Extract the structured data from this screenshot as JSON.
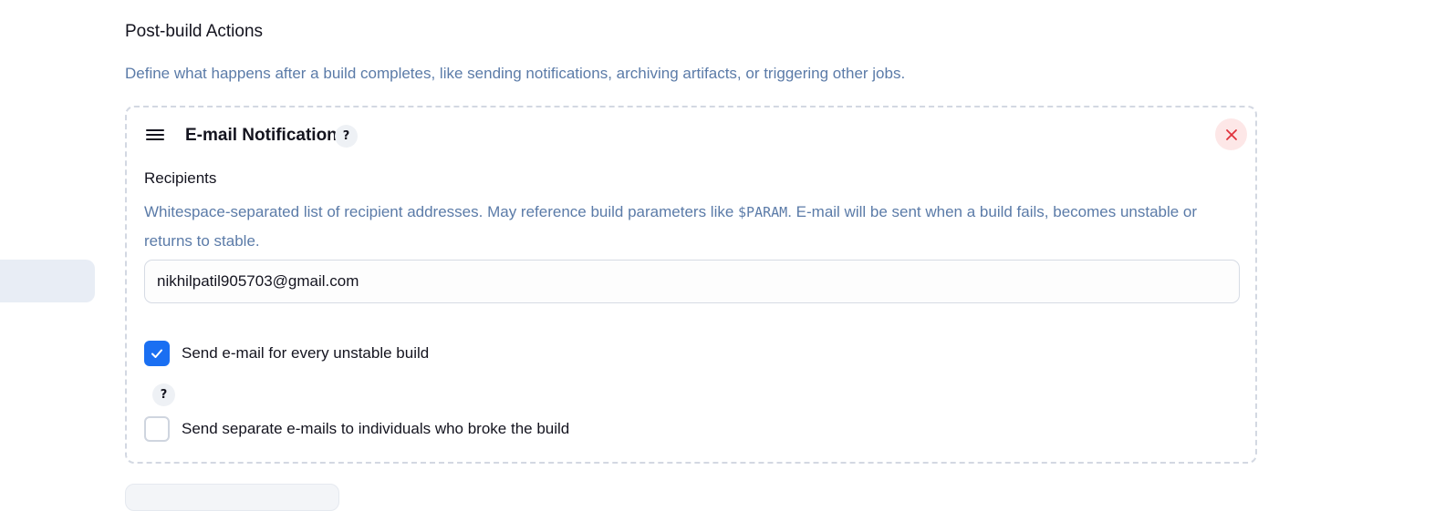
{
  "section": {
    "title": "Post-build Actions",
    "description": "Define what happens after a build completes, like sending notifications, archiving artifacts, or triggering other jobs."
  },
  "email_notification": {
    "title": "E-mail Notification",
    "help_label": "?",
    "recipients": {
      "label": "Recipients",
      "description_before": "Whitespace-separated list of recipient addresses. May reference build parameters like ",
      "description_code": "$PARAM",
      "description_after": ". E-mail will be sent when a build fails, becomes unstable or returns to stable.",
      "value": "nikhilpatil905703@gmail.com"
    },
    "options": {
      "unstable": {
        "label": "Send e-mail for every unstable build",
        "checked": true
      },
      "help_label": "?",
      "separate": {
        "label": "Send separate e-mails to individuals who broke the build",
        "checked": false
      }
    }
  },
  "icons": {
    "drag": "drag-handle-icon",
    "delete": "close-icon",
    "check": "checkmark-icon"
  },
  "colors": {
    "accent": "#1a6ff2",
    "description_text": "#5b7ba8",
    "delete_icon": "#e0323c",
    "delete_bg": "#fde7e7"
  }
}
